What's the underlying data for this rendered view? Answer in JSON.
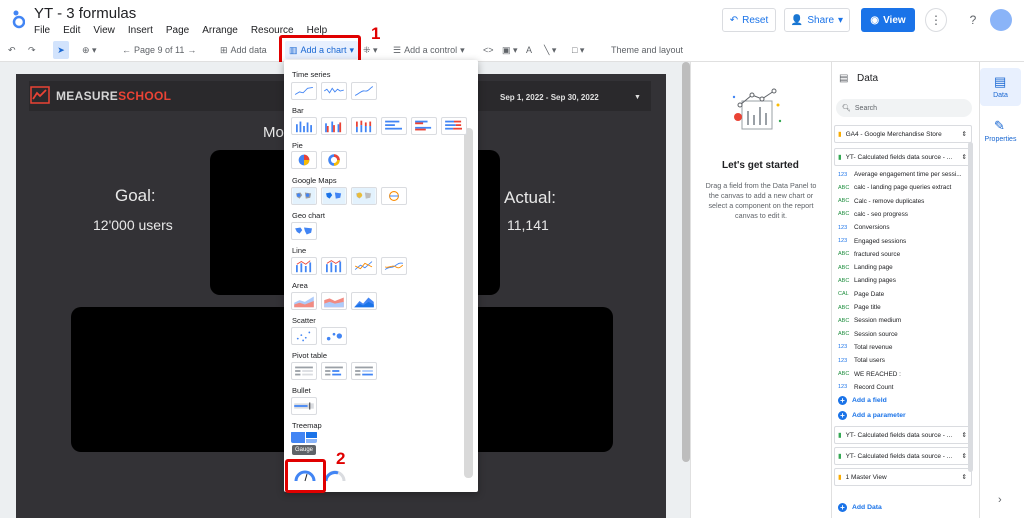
{
  "app": {
    "title": "YT - 3 formulas",
    "menu": [
      "File",
      "Edit",
      "View",
      "Insert",
      "Page",
      "Arrange",
      "Resource",
      "Help"
    ],
    "reset_label": "Reset",
    "share_label": "Share",
    "view_label": "View"
  },
  "toolbar": {
    "page_indicator": "Page 9 of 11",
    "add_data": "Add data",
    "add_chart": "Add a chart",
    "add_control": "Add a control",
    "theme_layout": "Theme and layout"
  },
  "annotations": {
    "marker1": "1",
    "marker2": "2",
    "color": "#e00000"
  },
  "report": {
    "brand_a": "MEASURE",
    "brand_b": "SCHOOL",
    "date_range": "Sep 1, 2022 - Sep 30, 2022",
    "mo_text": "Mo",
    "goal_label": "Goal:",
    "goal_value": "12'000 users",
    "actual_label": "Actual:",
    "actual_value": "11,141"
  },
  "chart_menu": {
    "sections": [
      "Time series",
      "Bar",
      "Pie",
      "Google Maps",
      "Geo chart",
      "Line",
      "Area",
      "Scatter",
      "Pivot table",
      "Bullet",
      "Treemap"
    ],
    "tooltip": "Gauge"
  },
  "middle": {
    "title": "Let's get started",
    "desc": "Drag a field from the Data Panel to the canvas to add a new chart or select a component on the report canvas to edit it."
  },
  "data_panel": {
    "title": "Data",
    "search_placeholder": "Search",
    "sources": [
      "GA4 - Google Merchandise Store",
      "YT- Calculated fields data source - ..."
    ],
    "fields": [
      {
        "type": "123",
        "label": "Average engagement time per sessi..."
      },
      {
        "type": "ABC",
        "label": "calc - landing page queries extract"
      },
      {
        "type": "ABC",
        "label": "Calc - remove duplicates"
      },
      {
        "type": "ABC",
        "label": "calc - seo progress"
      },
      {
        "type": "123",
        "label": "Conversions"
      },
      {
        "type": "123",
        "label": "Engaged sessions"
      },
      {
        "type": "ABC",
        "label": "fractured source"
      },
      {
        "type": "ABC",
        "label": "Landing page"
      },
      {
        "type": "ABC",
        "label": "Landing pages"
      },
      {
        "type": "CAL",
        "label": "Page Date"
      },
      {
        "type": "ABC",
        "label": "Page title"
      },
      {
        "type": "ABC",
        "label": "Session medium"
      },
      {
        "type": "ABC",
        "label": "Session source"
      },
      {
        "type": "123",
        "label": "Total revenue"
      },
      {
        "type": "123",
        "label": "Total users"
      },
      {
        "type": "ABC",
        "label": "WE REACHED :"
      },
      {
        "type": "123",
        "label": "Record Count"
      }
    ],
    "add_field": "Add a field",
    "add_parameter": "Add a parameter",
    "more_sources": [
      "YT- Calculated fields data source - ...",
      "YT- Calculated fields data source - ...",
      "1 Master View"
    ],
    "add_data": "Add Data"
  },
  "rail": {
    "data_label": "Data",
    "properties_label": "Properties"
  }
}
